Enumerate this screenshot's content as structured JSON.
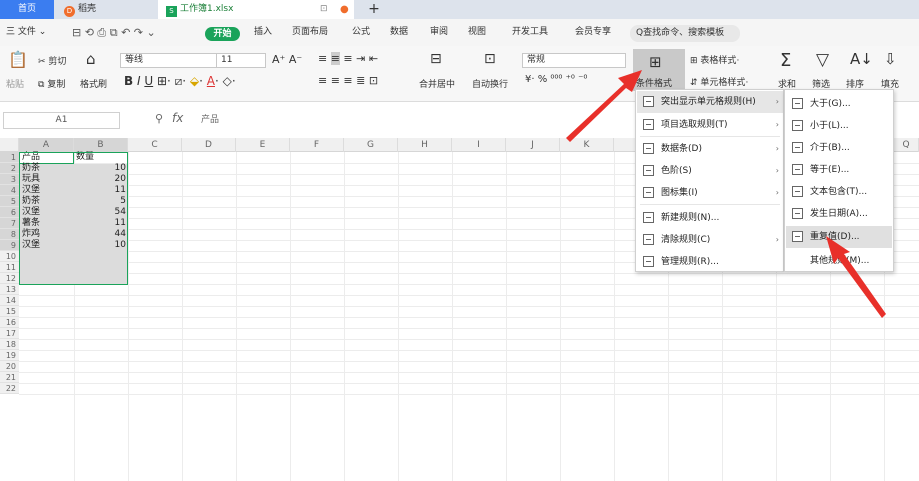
{
  "tabbar": {
    "home": "首页",
    "daoke": "稻壳",
    "workbook": "工作簿1.xlsx",
    "plus": "+"
  },
  "menubar": {
    "file": "三 文件 ⌄",
    "items": [
      "开始",
      "插入",
      "页面布局",
      "公式",
      "数据",
      "审阅",
      "视图",
      "开发工具",
      "会员专享"
    ],
    "search": "Q查找命令、搜索模板"
  },
  "ribbon": {
    "paste": "粘贴",
    "cut": "剪切",
    "copy": "复制",
    "format_painter": "格式刷",
    "font_name": "等线",
    "font_size": "11",
    "merge_center": "合并居中",
    "wrap_text": "自动换行",
    "number_format": "常规",
    "conditional_format": "条件格式",
    "table_style": "表格样式",
    "cell_style": "单元格样式",
    "sum": "求和",
    "filter": "筛选",
    "sort": "排序",
    "fill": "填充"
  },
  "formulabar": {
    "namebox": "A1",
    "fx": "fx",
    "content": "产品"
  },
  "grid": {
    "columns": [
      "A",
      "B",
      "C",
      "D",
      "E",
      "F",
      "G",
      "H",
      "I",
      "J",
      "K",
      "Q"
    ],
    "rows": [
      "1",
      "2",
      "3",
      "4",
      "5",
      "6",
      "7",
      "8",
      "9",
      "10",
      "11",
      "12",
      "13",
      "14",
      "15",
      "16",
      "17",
      "18",
      "19",
      "20",
      "21",
      "22"
    ],
    "headers": [
      "产品",
      "数量"
    ],
    "data": [
      {
        "product": "奶茶",
        "qty": "10"
      },
      {
        "product": "玩具",
        "qty": "20"
      },
      {
        "product": "汉堡",
        "qty": "11"
      },
      {
        "product": "奶茶",
        "qty": "5"
      },
      {
        "product": "汉堡",
        "qty": "54"
      },
      {
        "product": "薯条",
        "qty": "11"
      },
      {
        "product": "炸鸡",
        "qty": "44"
      },
      {
        "product": "汉堡",
        "qty": "10"
      }
    ]
  },
  "menu1": [
    {
      "label": "突出显示单元格规则(H)",
      "submenu": true
    },
    {
      "label": "项目选取规则(T)",
      "submenu": true
    },
    {
      "label": "数据条(D)",
      "submenu": true
    },
    {
      "label": "色阶(S)",
      "submenu": true
    },
    {
      "label": "图标集(I)",
      "submenu": true
    },
    {
      "label": "新建规则(N)...",
      "submenu": false
    },
    {
      "label": "清除规则(C)",
      "submenu": true
    },
    {
      "label": "管理规则(R)...",
      "submenu": false
    }
  ],
  "menu2": [
    {
      "label": "大于(G)..."
    },
    {
      "label": "小于(L)..."
    },
    {
      "label": "介于(B)..."
    },
    {
      "label": "等于(E)..."
    },
    {
      "label": "文本包含(T)..."
    },
    {
      "label": "发生日期(A)..."
    },
    {
      "label": "重复值(D)..."
    },
    {
      "label": "其他规则(M)..."
    }
  ],
  "colors": {
    "accent_blue": "#3b7df0",
    "start_green": "#1aa35a",
    "arrow_red": "#e8302a",
    "selection": "#dcdcdc"
  }
}
